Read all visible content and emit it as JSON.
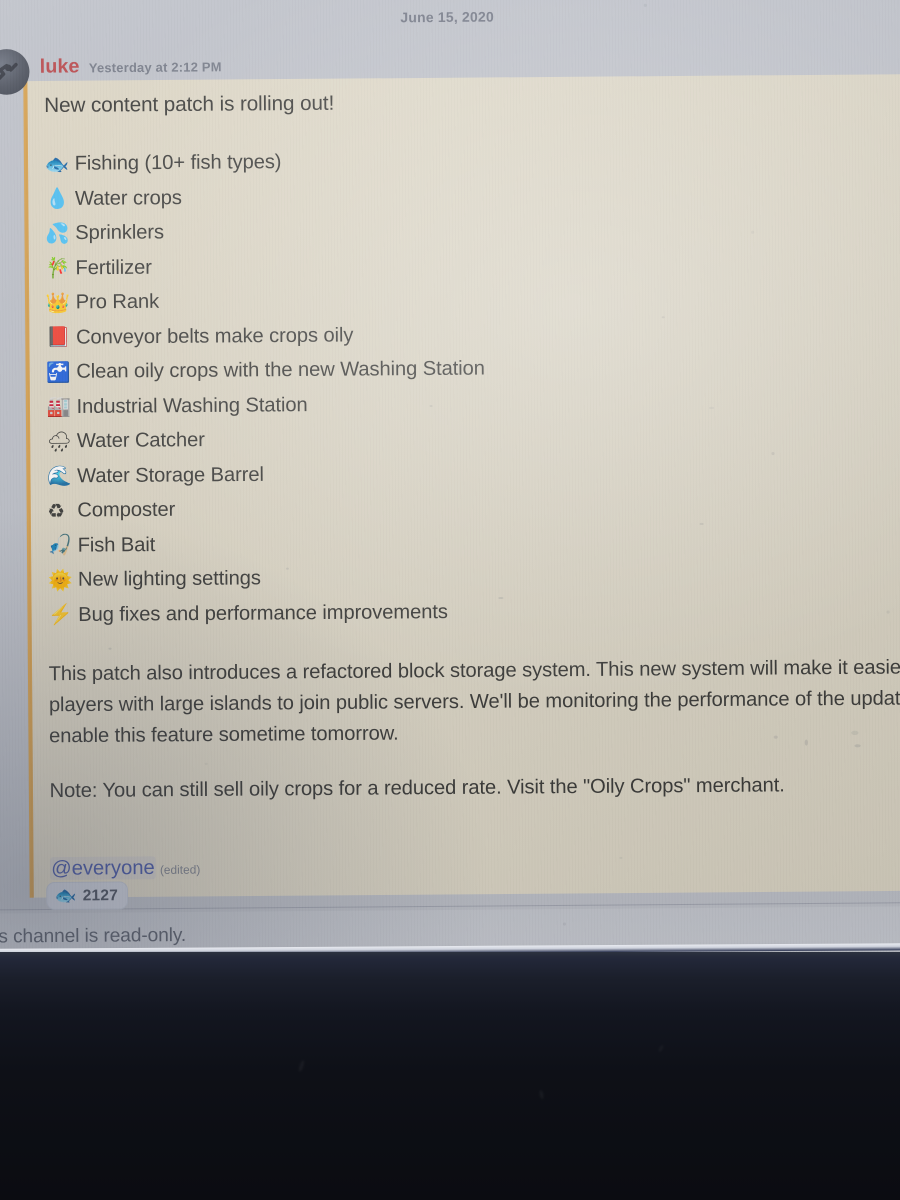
{
  "app": {
    "type": "chat-message",
    "platform_look": "discord"
  },
  "colors": {
    "page_background": "#bfc2ca",
    "mention_highlight_background": "#ded7c5",
    "mention_accent_border": "#d8a250",
    "author_name": "#b9474b",
    "mention_text": "#4a5aa8",
    "body_text": "#3a3a38",
    "muted_text": "#737886",
    "bezel": "#0e1017"
  },
  "date_divider": {
    "label": "June 15, 2020"
  },
  "message": {
    "author": "luke",
    "timestamp": "Yesterday at 2:12 PM",
    "avatar_name": "user-avatar",
    "headline": "New content patch is rolling out!",
    "features": [
      {
        "emoji": "🐟",
        "emoji_name": "fish-emoji",
        "label": "Fishing (10+ fish types)"
      },
      {
        "emoji": "💧",
        "emoji_name": "droplet-emoji",
        "label": "Water crops"
      },
      {
        "emoji": "💦",
        "emoji_name": "sweat-droplets-emoji",
        "label": "Sprinklers"
      },
      {
        "emoji": "🎋",
        "emoji_name": "tanabata-tree-emoji",
        "label": "Fertilizer"
      },
      {
        "emoji": "👑",
        "emoji_name": "crown-emoji",
        "label": "Pro Rank"
      },
      {
        "emoji": "📕",
        "emoji_name": "closed-book-emoji",
        "label": "Conveyor belts make crops oily"
      },
      {
        "emoji": "🚰",
        "emoji_name": "potable-water-emoji",
        "label": "Clean oily crops with the new Washing Station"
      },
      {
        "emoji": "🏭",
        "emoji_name": "factory-emoji",
        "label": "Industrial Washing Station"
      },
      {
        "emoji": "🌧",
        "emoji_name": "cloud-with-rain-emoji",
        "label": "Water Catcher"
      },
      {
        "emoji": "🌊",
        "emoji_name": "water-wave-emoji",
        "label": "Water Storage Barrel"
      },
      {
        "emoji": "♻",
        "emoji_name": "recycling-emoji",
        "label": "Composter"
      },
      {
        "emoji": "🎣",
        "emoji_name": "fishing-pole-emoji",
        "label": "Fish Bait"
      },
      {
        "emoji": "🌞",
        "emoji_name": "sun-with-face-emoji",
        "label": "New lighting settings"
      },
      {
        "emoji": "⚡",
        "emoji_name": "high-voltage-emoji",
        "label": "Bug fixes and performance improvements"
      }
    ],
    "paragraph_1": "This patch also introduces a refactored block storage system. This new system will make it easier for players with large islands to join public servers. We'll be monitoring the performance of the update and enable this feature sometime tomorrow.",
    "paragraph_2": "Note: You can still sell oily crops for a reduced rate. Visit the \"Oily Crops\" merchant.",
    "mention": "@everyone",
    "edited_label": "(edited)"
  },
  "reaction": {
    "emoji": "🐟",
    "emoji_name": "fish-emoji",
    "count": "2127"
  },
  "footer": {
    "read_only_notice": "This channel is read-only."
  }
}
